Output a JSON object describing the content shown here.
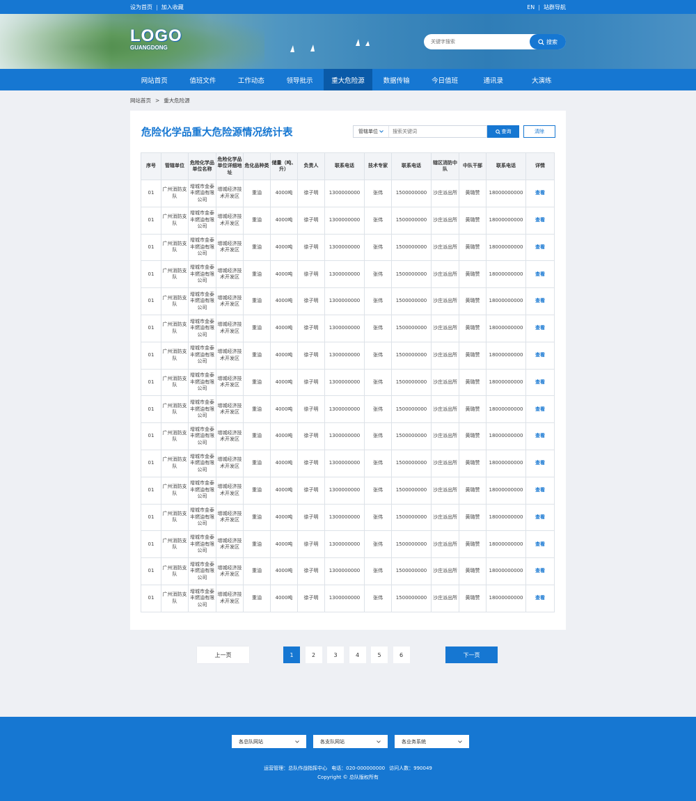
{
  "topbar": {
    "set_home": "设为首页",
    "add_fav": "加入收藏",
    "separator": "|",
    "lang": "EN",
    "site_nav": "站群导航"
  },
  "logo": {
    "main": "LOGO",
    "sub": "GUANGDONG"
  },
  "search": {
    "placeholder": "关键字搜索",
    "button": "搜索"
  },
  "nav": {
    "items": [
      {
        "label": "网站首页"
      },
      {
        "label": "值班文件"
      },
      {
        "label": "工作动态"
      },
      {
        "label": "领导批示"
      },
      {
        "label": "重大危险源"
      },
      {
        "label": "数据传输"
      },
      {
        "label": "今日值班"
      },
      {
        "label": "通讯录"
      },
      {
        "label": "大演练"
      }
    ],
    "active_index": 4
  },
  "breadcrumb": {
    "home": "网站首页",
    "arrow": ">",
    "current": "重大危险源"
  },
  "panel": {
    "title": "危险化学品重大危险源情况统计表",
    "filter_select": "管辖单位",
    "keyword_placeholder": "搜索关键词",
    "query_button": "查询",
    "clear_button": "清除"
  },
  "table": {
    "headers": [
      "序号",
      "管辖单位",
      "危险化学品单位名称",
      "危险化学品单位详细地址",
      "危化品种类",
      "储量（吨、升）",
      "负责人",
      "联系电话",
      "技术专家",
      "联系电话",
      "辖区消防中队",
      "中队干部",
      "联系电话",
      "详情"
    ],
    "rows": [
      [
        "01",
        "广州消防支队",
        "增城市金泰丰燃油有限公司",
        "增城经济技术开发区",
        "重油",
        "4000吨",
        "徐子明",
        "1300000000",
        "张伟",
        "1500000000",
        "沙庄派出所",
        "黄璐赞",
        "18000000000",
        "查看"
      ],
      [
        "01",
        "广州消防支队",
        "增城市金泰丰燃油有限公司",
        "增城经济技术开发区",
        "重油",
        "4000吨",
        "徐子明",
        "1300000000",
        "张伟",
        "1500000000",
        "沙庄派出所",
        "黄璐赞",
        "18000000000",
        "查看"
      ],
      [
        "01",
        "广州消防支队",
        "增城市金泰丰燃油有限公司",
        "增城经济技术开发区",
        "重油",
        "4000吨",
        "徐子明",
        "1300000000",
        "张伟",
        "1500000000",
        "沙庄派出所",
        "黄璐赞",
        "18000000000",
        "查看"
      ],
      [
        "01",
        "广州消防支队",
        "增城市金泰丰燃油有限公司",
        "增城经济技术开发区",
        "重油",
        "4000吨",
        "徐子明",
        "1300000000",
        "张伟",
        "1500000000",
        "沙庄派出所",
        "黄璐赞",
        "18000000000",
        "查看"
      ],
      [
        "01",
        "广州消防支队",
        "增城市金泰丰燃油有限公司",
        "增城经济技术开发区",
        "重油",
        "4000吨",
        "徐子明",
        "1300000000",
        "张伟",
        "1500000000",
        "沙庄派出所",
        "黄璐赞",
        "18000000000",
        "查看"
      ],
      [
        "01",
        "广州消防支队",
        "增城市金泰丰燃油有限公司",
        "增城经济技术开发区",
        "重油",
        "4000吨",
        "徐子明",
        "1300000000",
        "张伟",
        "1500000000",
        "沙庄派出所",
        "黄璐赞",
        "18000000000",
        "查看"
      ],
      [
        "01",
        "广州消防支队",
        "增城市金泰丰燃油有限公司",
        "增城经济技术开发区",
        "重油",
        "4000吨",
        "徐子明",
        "1300000000",
        "张伟",
        "1500000000",
        "沙庄派出所",
        "黄璐赞",
        "18000000000",
        "查看"
      ],
      [
        "01",
        "广州消防支队",
        "增城市金泰丰燃油有限公司",
        "增城经济技术开发区",
        "重油",
        "4000吨",
        "徐子明",
        "1300000000",
        "张伟",
        "1500000000",
        "沙庄派出所",
        "黄璐赞",
        "18000000000",
        "查看"
      ],
      [
        "01",
        "广州消防支队",
        "增城市金泰丰燃油有限公司",
        "增城经济技术开发区",
        "重油",
        "4000吨",
        "徐子明",
        "1300000000",
        "张伟",
        "1500000000",
        "沙庄派出所",
        "黄璐赞",
        "18000000000",
        "查看"
      ],
      [
        "01",
        "广州消防支队",
        "增城市金泰丰燃油有限公司",
        "增城经济技术开发区",
        "重油",
        "4000吨",
        "徐子明",
        "1300000000",
        "张伟",
        "1500000000",
        "沙庄派出所",
        "黄璐赞",
        "18000000000",
        "查看"
      ],
      [
        "01",
        "广州消防支队",
        "增城市金泰丰燃油有限公司",
        "增城经济技术开发区",
        "重油",
        "4000吨",
        "徐子明",
        "1300000000",
        "张伟",
        "1500000000",
        "沙庄派出所",
        "黄璐赞",
        "18000000000",
        "查看"
      ],
      [
        "01",
        "广州消防支队",
        "增城市金泰丰燃油有限公司",
        "增城经济技术开发区",
        "重油",
        "4000吨",
        "徐子明",
        "1300000000",
        "张伟",
        "1500000000",
        "沙庄派出所",
        "黄璐赞",
        "18000000000",
        "查看"
      ],
      [
        "01",
        "广州消防支队",
        "增城市金泰丰燃油有限公司",
        "增城经济技术开发区",
        "重油",
        "4000吨",
        "徐子明",
        "1300000000",
        "张伟",
        "1500000000",
        "沙庄派出所",
        "黄璐赞",
        "18000000000",
        "查看"
      ],
      [
        "01",
        "广州消防支队",
        "增城市金泰丰燃油有限公司",
        "增城经济技术开发区",
        "重油",
        "4000吨",
        "徐子明",
        "1300000000",
        "张伟",
        "1500000000",
        "沙庄派出所",
        "黄璐赞",
        "18000000000",
        "查看"
      ],
      [
        "01",
        "广州消防支队",
        "增城市金泰丰燃油有限公司",
        "增城经济技术开发区",
        "重油",
        "4000吨",
        "徐子明",
        "1300000000",
        "张伟",
        "1500000000",
        "沙庄派出所",
        "黄璐赞",
        "18000000000",
        "查看"
      ],
      [
        "01",
        "广州消防支队",
        "增城市金泰丰燃油有限公司",
        "增城经济技术开发区",
        "重油",
        "4000吨",
        "徐子明",
        "1300000000",
        "张伟",
        "1500000000",
        "沙庄派出所",
        "黄璐赞",
        "18000000000",
        "查看"
      ]
    ]
  },
  "pager": {
    "prev": "上一页",
    "next": "下一页",
    "pages": [
      "1",
      "2",
      "3",
      "4",
      "5",
      "6"
    ],
    "active_index": 0
  },
  "footer": {
    "dropdowns": [
      "各总队网站",
      "各支队网站",
      "各业务系统"
    ],
    "operator": "运营管理：总队作战指挥中心",
    "phone": "电话：020-000000000",
    "visits": "访问人数：990049",
    "copyright": "Copyright © 总队版权所有"
  },
  "colors": {
    "primary": "#1677d2",
    "active_nav": "#0a5aa8",
    "page_bg": "#eef0f4"
  },
  "icons": {
    "search_button": "search-icon",
    "select_arrow": "chevron-down-icon"
  }
}
